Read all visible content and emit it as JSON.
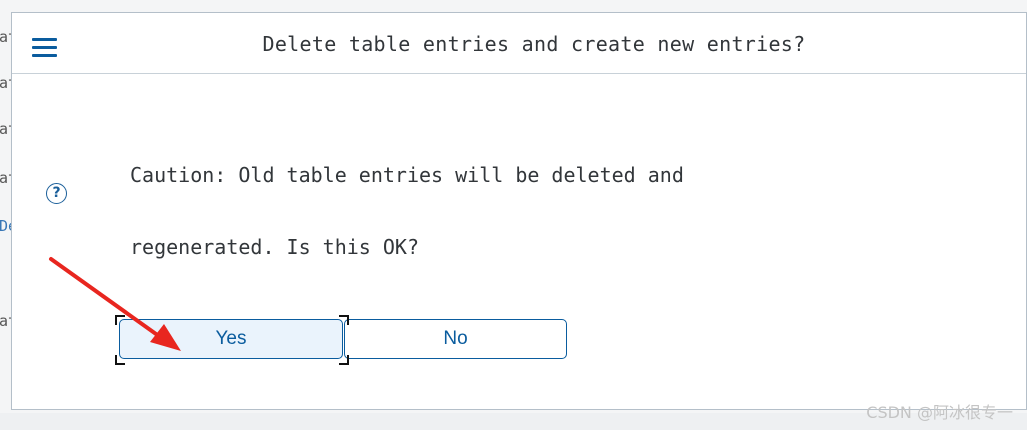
{
  "background": {
    "fragments": [
      {
        "text": "at",
        "link": false
      },
      {
        "text": "at",
        "link": false
      },
      {
        "text": "at",
        "link": false
      },
      {
        "text": "at",
        "link": false
      },
      {
        "text": "De",
        "link": true
      },
      {
        "text": "at",
        "link": false
      }
    ]
  },
  "dialog": {
    "title": "Delete table entries and create new entries?",
    "menu_icon": "hamburger-menu-icon",
    "help_icon": "question-circle-icon",
    "help_glyph": "?",
    "message_line1": "Caution: Old table entries will be deleted and",
    "message_line2": "regenerated. Is this OK?",
    "yes_label": "Yes",
    "no_label": "No"
  },
  "annotation": {
    "arrow_color": "#e8261f"
  },
  "watermark": "CSDN @阿冰很专一",
  "colors": {
    "accent": "#0a5c9e",
    "text": "#32363a",
    "yes_fill": "#eaf3fc"
  }
}
